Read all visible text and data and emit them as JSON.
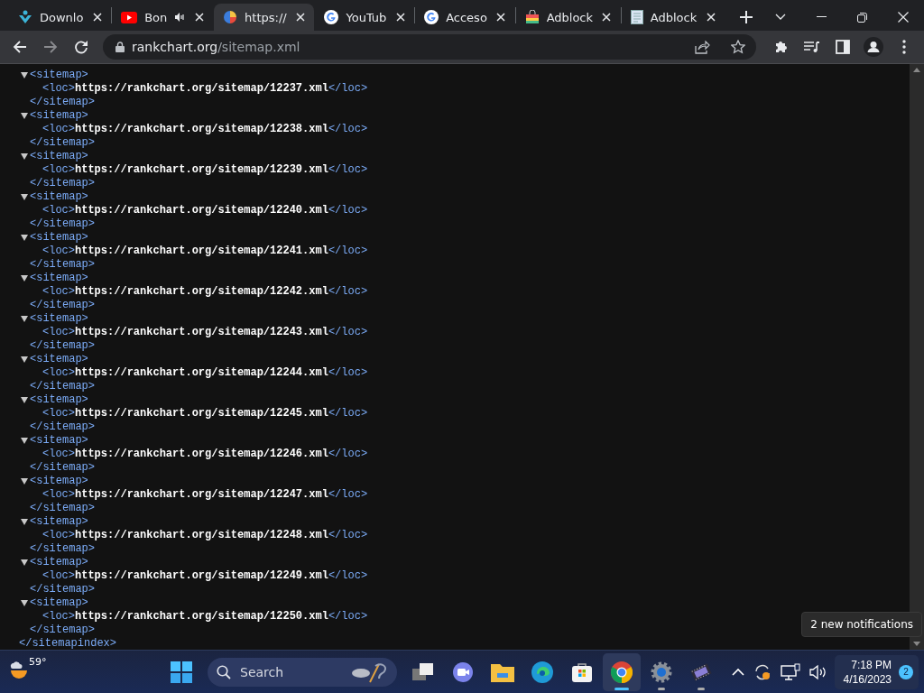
{
  "tabs": [
    {
      "kind": "download",
      "title": "Downlo",
      "selected": false,
      "audio": false
    },
    {
      "kind": "youtube",
      "title": "Bon",
      "selected": false,
      "audio": true
    },
    {
      "kind": "pie",
      "title": "https://",
      "selected": true,
      "audio": false
    },
    {
      "kind": "google",
      "title": "YouTub",
      "selected": false,
      "audio": false
    },
    {
      "kind": "google",
      "title": "Acceso",
      "selected": false,
      "audio": false
    },
    {
      "kind": "bag",
      "title": "Adblock",
      "selected": false,
      "audio": false
    },
    {
      "kind": "document",
      "title": "Adblock",
      "selected": false,
      "audio": false
    }
  ],
  "address": {
    "host": "rankchart.org",
    "path": "/sitemap.xml"
  },
  "xml": {
    "entries": [
      {
        "expanded": true,
        "open": "<sitemap>",
        "loc_open": "<loc>",
        "url": "https://rankchart.org/sitemap/12237.xml",
        "loc_close": "</loc>",
        "close": "</sitemap>"
      },
      {
        "expanded": true,
        "open": "<sitemap>",
        "loc_open": "<loc>",
        "url": "https://rankchart.org/sitemap/12238.xml",
        "loc_close": "</loc>",
        "close": "</sitemap>"
      },
      {
        "expanded": true,
        "open": "<sitemap>",
        "loc_open": "<loc>",
        "url": "https://rankchart.org/sitemap/12239.xml",
        "loc_close": "</loc>",
        "close": "</sitemap>"
      },
      {
        "expanded": true,
        "open": "<sitemap>",
        "loc_open": "<loc>",
        "url": "https://rankchart.org/sitemap/12240.xml",
        "loc_close": "</loc>",
        "close": "</sitemap>"
      },
      {
        "expanded": true,
        "open": "<sitemap>",
        "loc_open": "<loc>",
        "url": "https://rankchart.org/sitemap/12241.xml",
        "loc_close": "</loc>",
        "close": "</sitemap>"
      },
      {
        "expanded": true,
        "open": "<sitemap>",
        "loc_open": "<loc>",
        "url": "https://rankchart.org/sitemap/12242.xml",
        "loc_close": "</loc>",
        "close": "</sitemap>"
      },
      {
        "expanded": true,
        "open": "<sitemap>",
        "loc_open": "<loc>",
        "url": "https://rankchart.org/sitemap/12243.xml",
        "loc_close": "</loc>",
        "close": "</sitemap>"
      },
      {
        "expanded": true,
        "open": "<sitemap>",
        "loc_open": "<loc>",
        "url": "https://rankchart.org/sitemap/12244.xml",
        "loc_close": "</loc>",
        "close": "</sitemap>"
      },
      {
        "expanded": true,
        "open": "<sitemap>",
        "loc_open": "<loc>",
        "url": "https://rankchart.org/sitemap/12245.xml",
        "loc_close": "</loc>",
        "close": "</sitemap>"
      },
      {
        "expanded": true,
        "open": "<sitemap>",
        "loc_open": "<loc>",
        "url": "https://rankchart.org/sitemap/12246.xml",
        "loc_close": "</loc>",
        "close": "</sitemap>"
      },
      {
        "expanded": true,
        "open": "<sitemap>",
        "loc_open": "<loc>",
        "url": "https://rankchart.org/sitemap/12247.xml",
        "loc_close": "</loc>",
        "close": "</sitemap>"
      },
      {
        "expanded": true,
        "open": "<sitemap>",
        "loc_open": "<loc>",
        "url": "https://rankchart.org/sitemap/12248.xml",
        "loc_close": "</loc>",
        "close": "</sitemap>"
      },
      {
        "expanded": true,
        "open": "<sitemap>",
        "loc_open": "<loc>",
        "url": "https://rankchart.org/sitemap/12249.xml",
        "loc_close": "</loc>",
        "close": "</sitemap>"
      },
      {
        "expanded": true,
        "open": "<sitemap>",
        "loc_open": "<loc>",
        "url": "https://rankchart.org/sitemap/12250.xml",
        "loc_close": "</loc>",
        "close": "</sitemap>"
      }
    ],
    "root_close": "</sitemapindex>"
  },
  "tooltip": "2 new notifications",
  "taskbar": {
    "weather": "59°",
    "search_placeholder": "Search",
    "apps": [
      {
        "kind": "task-view",
        "running": false,
        "selected": false
      },
      {
        "kind": "chat",
        "running": false,
        "selected": false
      },
      {
        "kind": "folder",
        "running": false,
        "selected": false
      },
      {
        "kind": "edge",
        "running": false,
        "selected": false
      },
      {
        "kind": "store",
        "running": false,
        "selected": false
      },
      {
        "kind": "chrome",
        "running": true,
        "selected": true
      },
      {
        "kind": "gear",
        "running": true,
        "selected": false
      },
      {
        "kind": "film",
        "running": true,
        "selected": false
      }
    ],
    "time": "7:18 PM",
    "date": "4/16/2023",
    "notification_count": "2"
  }
}
